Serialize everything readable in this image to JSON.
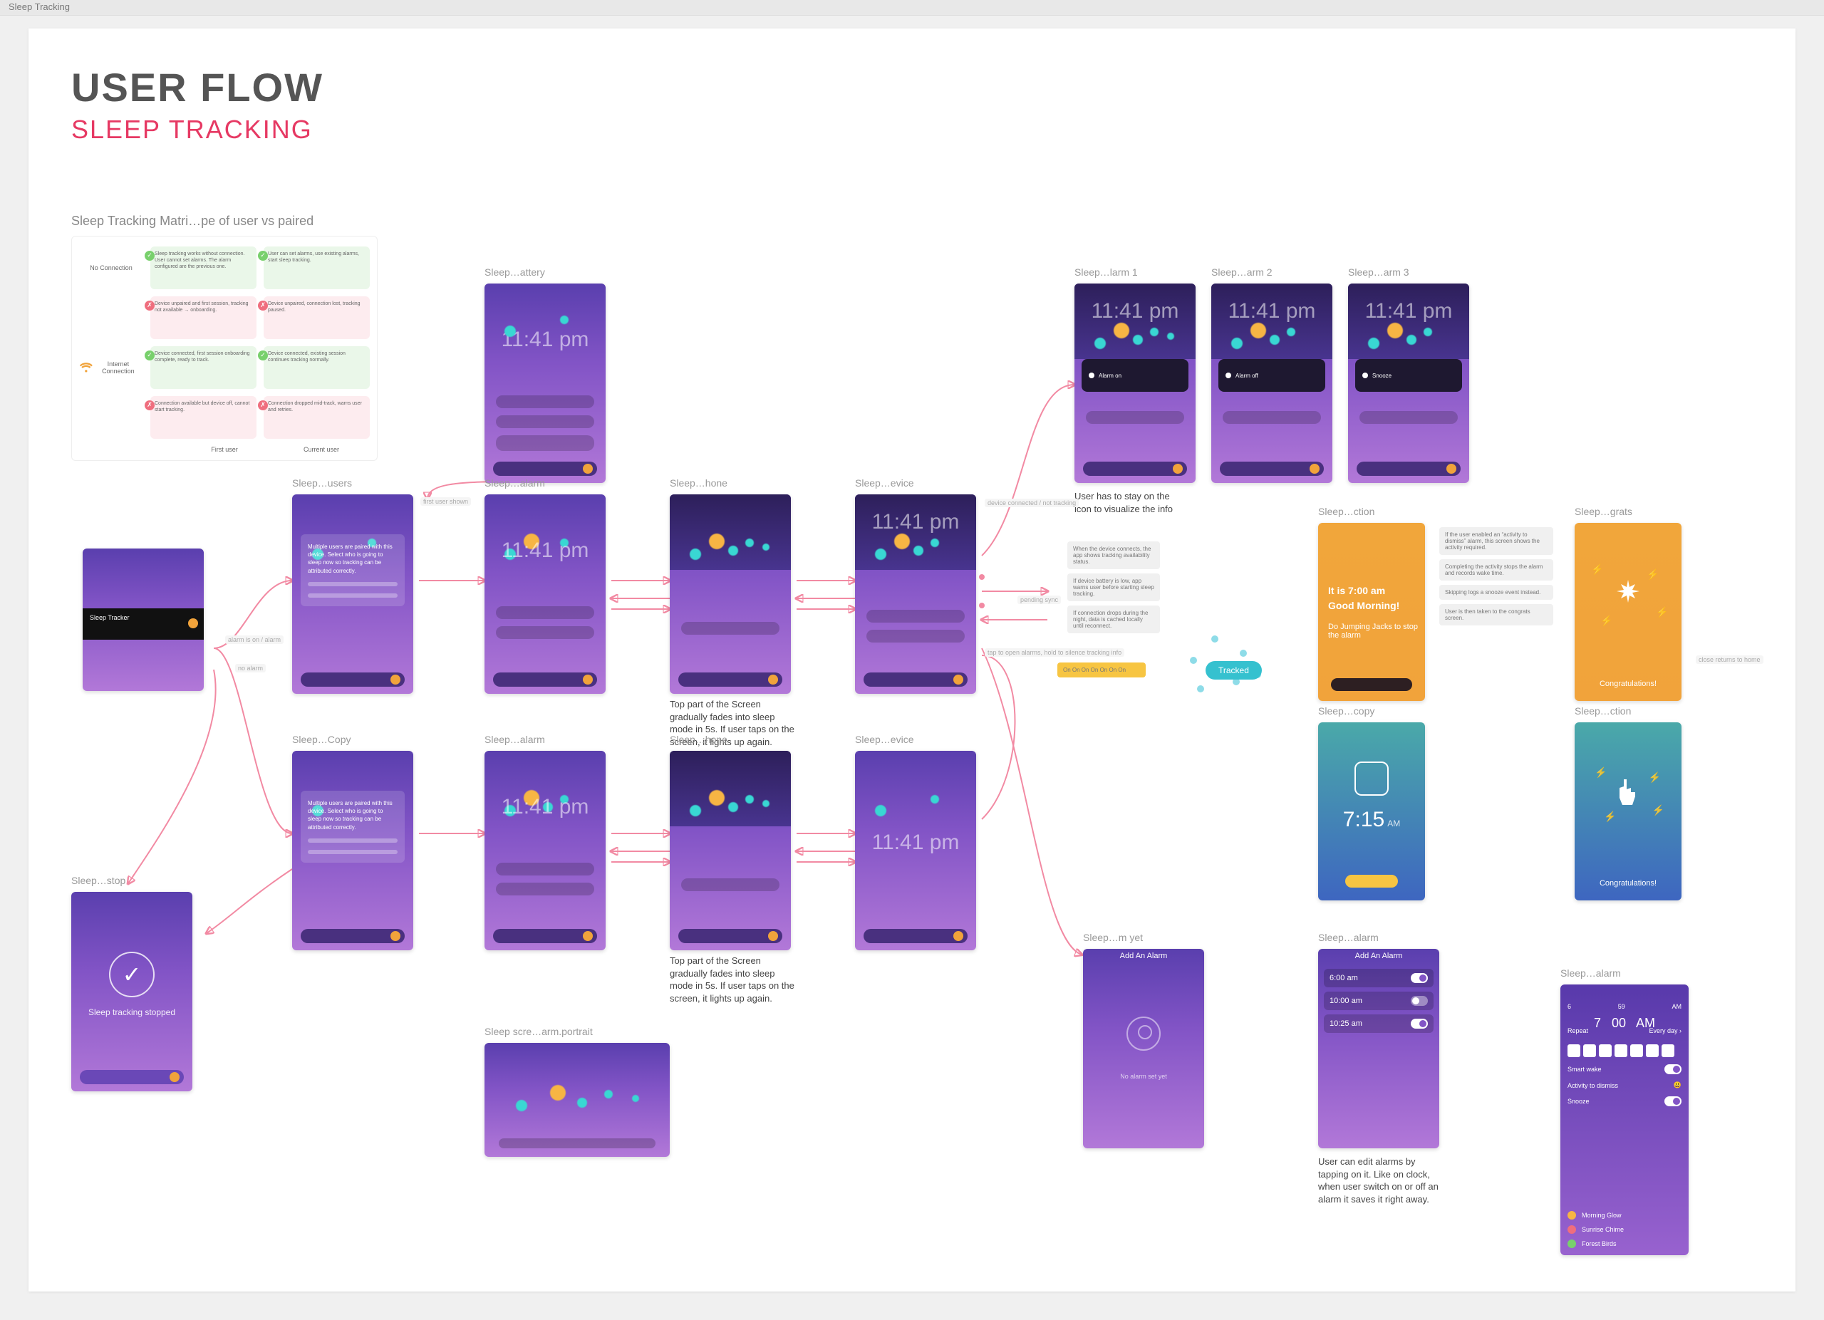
{
  "window": {
    "title": "Sleep Tracking"
  },
  "header": {
    "title": "USER FLOW",
    "subtitle": "SLEEP TRACKING"
  },
  "matrix": {
    "title": "Sleep Tracking Matri…pe of user vs paired",
    "rowLabels": [
      "No Connection",
      "Internet Connection"
    ],
    "colLabels": [
      "First user",
      "Current user"
    ]
  },
  "labels": {
    "battery": "Sleep…attery",
    "users": "Sleep…users",
    "usersCopy": "Sleep…Copy",
    "alarm": "Sleep…alarm",
    "hone": "Sleep…hone",
    "evice": "Sleep…evice",
    "larm1": "Sleep…larm 1",
    "arm2": "Sleep…arm 2",
    "arm3": "Sleep…arm 3",
    "ction": "Sleep…ction",
    "grats": "Sleep…grats",
    "copy": "Sleep…copy",
    "ction2": "Sleep…ction",
    "stop": "Sleep…stop",
    "myet": "Sleep…m yet",
    "aalarm": "Sleep…alarm",
    "alarmDetail": "Sleep…alarm",
    "landscape": "Sleep scre…arm.portrait"
  },
  "texts": {
    "clockTime": "11:41 pm",
    "alarmHeader": "Add An Alarm",
    "screenFade": "Top part of the Screen gradually fades into sleep mode in 5s. If user taps on the screen, it lights up again.",
    "iconHold": "User has to stay on the icon to visualize the info",
    "editAlarms": "User can edit alarms by tapping on it. Like on clock, when user switch on or off an alarm it saves it right away.",
    "goodMorning": "It is 7:00 am\nGood Morning!",
    "jumping": "Do Jumping Jacks to stop the alarm",
    "stopText": "Sleep tracking stopped",
    "introTitle": "Sleep Tracker",
    "bubble": "Tracked",
    "congr": "Congratulations!",
    "alarmTimes": [
      "6:00 am",
      "10:00 am",
      "10:25 am"
    ],
    "wakeTime": "7:15",
    "wakeSuffix": "AM"
  }
}
